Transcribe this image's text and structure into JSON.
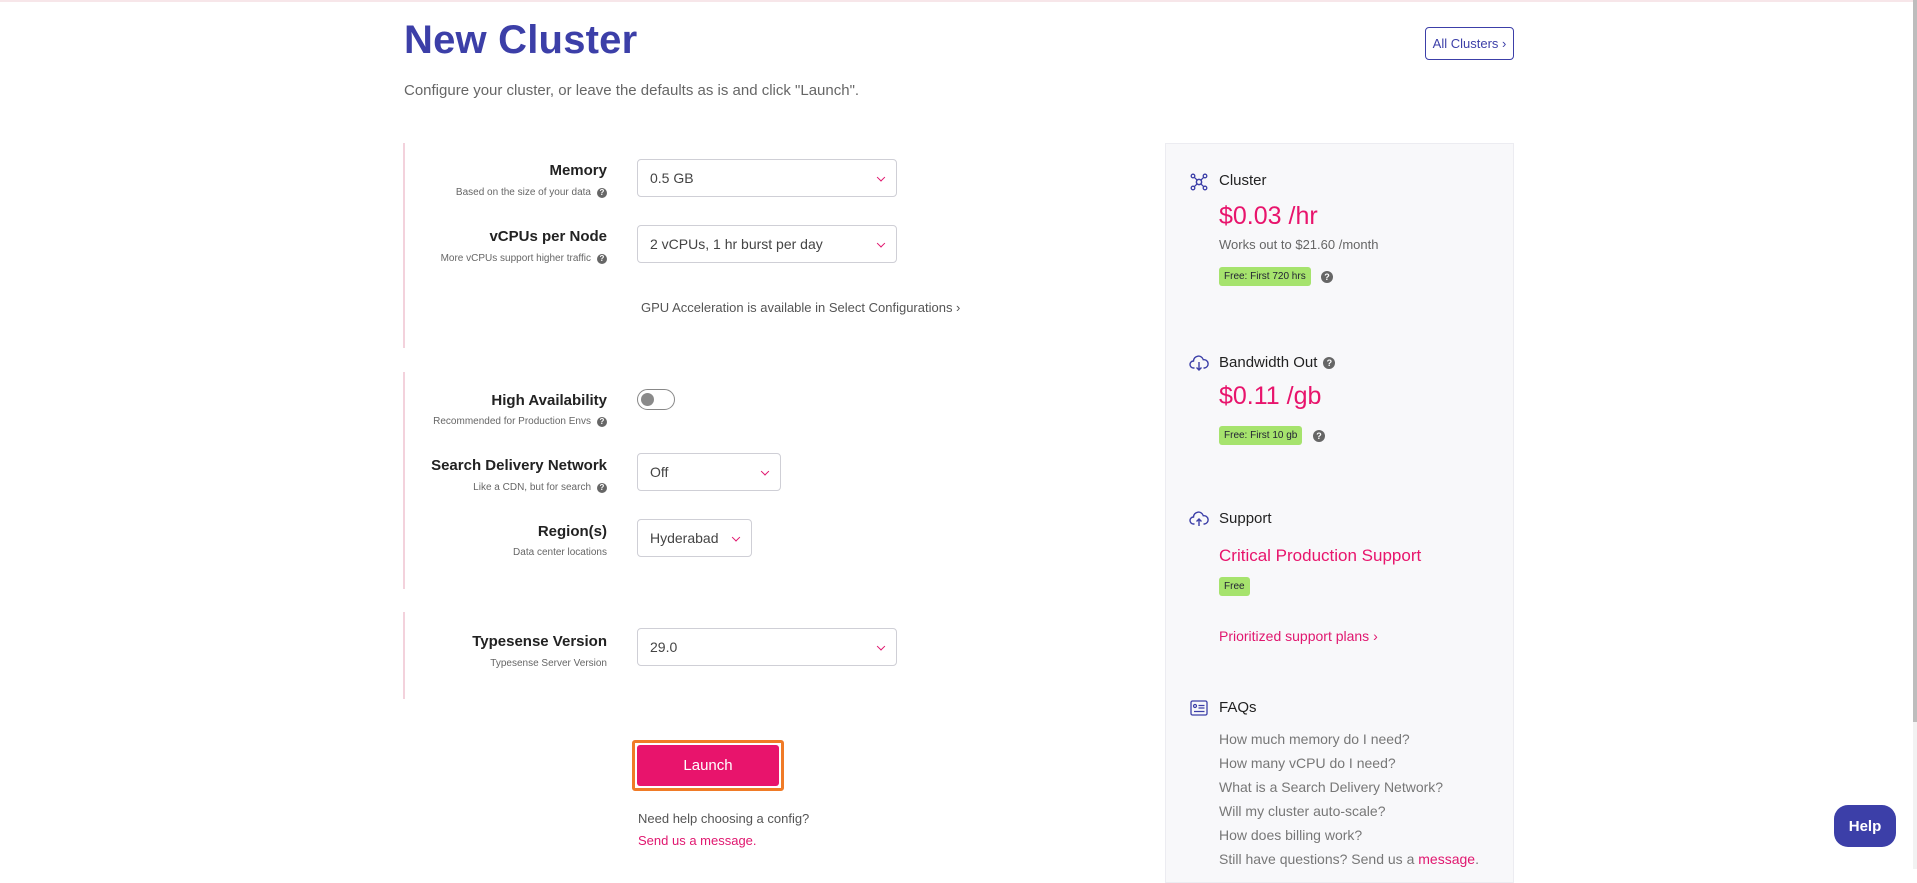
{
  "header": {
    "title": "New Cluster",
    "subtitle": "Configure your cluster, or leave the defaults as is and click \"Launch\".",
    "all_clusters_label": "All Clusters ›"
  },
  "form": {
    "memory": {
      "label": "Memory",
      "sub": "Based on the size of your data",
      "value": "0.5 GB"
    },
    "vcpus": {
      "label": "vCPUs per Node",
      "sub": "More vCPUs support higher traffic",
      "value": "2 vCPUs, 1 hr burst per day"
    },
    "gpu_link": "GPU Acceleration is available in Select Configurations ›",
    "high_availability": {
      "label": "High Availability",
      "sub": "Recommended for Production Envs",
      "enabled": false
    },
    "sdn": {
      "label": "Search Delivery Network",
      "sub": "Like a CDN, but for search",
      "value": "Off"
    },
    "regions": {
      "label": "Region(s)",
      "sub": "Data center locations",
      "value": "Hyderabad"
    },
    "version": {
      "label": "Typesense Version",
      "sub": "Typesense Server Version",
      "value": "29.0"
    },
    "launch_label": "Launch",
    "need_help": "Need help choosing a config?",
    "send_message": "Send us a message."
  },
  "panel": {
    "cluster": {
      "heading": "Cluster",
      "price": "$0.03 /hr",
      "sub": "Works out to $21.60 /month",
      "badge": "Free: First 720 hrs"
    },
    "bandwidth": {
      "heading": "Bandwidth Out",
      "price": "$0.11 /gb",
      "badge": "Free: First 10 gb"
    },
    "support": {
      "heading": "Support",
      "plan": "Critical Production Support",
      "badge": "Free",
      "link": "Prioritized support plans ›"
    },
    "faqs": {
      "heading": "FAQs",
      "items": [
        "How much memory do I need?",
        "How many vCPU do I need?",
        "What is a Search Delivery Network?",
        "Will my cluster auto-scale?",
        "How does billing work?"
      ],
      "last_prefix": "Still have questions? Send us a ",
      "last_link": "message",
      "last_suffix": "."
    }
  },
  "help_widget": {
    "label": "Help"
  },
  "colors": {
    "brand": "#3c3fa8",
    "accent": "#e8146c",
    "badge_green": "#a6e36d",
    "focus_outline": "#f07b27"
  }
}
